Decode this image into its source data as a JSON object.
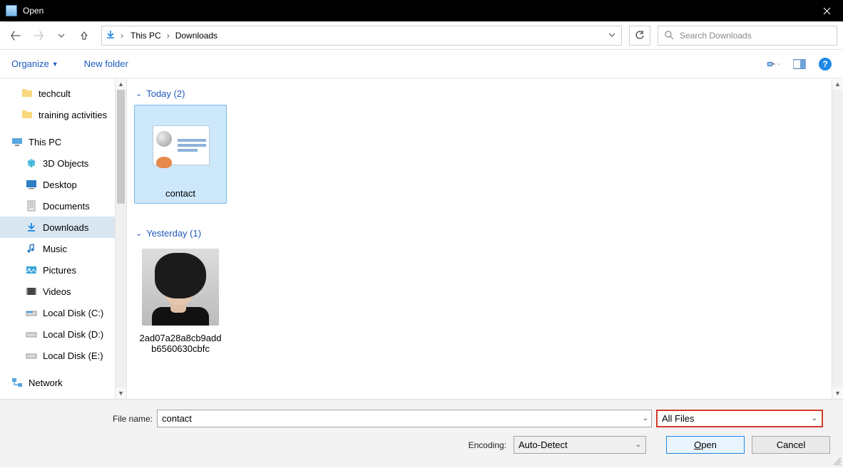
{
  "window": {
    "title": "Open"
  },
  "breadcrumb": {
    "root": "This PC",
    "folder": "Downloads"
  },
  "search": {
    "placeholder": "Search Downloads"
  },
  "toolbar": {
    "organize": "Organize",
    "new_folder": "New folder"
  },
  "sidebar": {
    "quick": [
      "techcult",
      "training activities"
    ],
    "this_pc": "This PC",
    "items": [
      "3D Objects",
      "Desktop",
      "Documents",
      "Downloads",
      "Music",
      "Pictures",
      "Videos",
      "Local Disk (C:)",
      "Local Disk (D:)",
      "Local Disk (E:)"
    ],
    "network": "Network"
  },
  "groups": {
    "today": {
      "label": "Today (2)",
      "items": [
        {
          "name": "contact",
          "selected": true
        }
      ]
    },
    "yesterday": {
      "label": "Yesterday (1)",
      "items": [
        {
          "name": "2ad07a28a8cb9addb6560630cbfc"
        }
      ]
    }
  },
  "footer": {
    "file_name_label": "File name:",
    "file_name_value": "contact",
    "file_type": "All Files",
    "encoding_label": "Encoding:",
    "encoding_value": "Auto-Detect",
    "open": "pen",
    "open_accel": "O",
    "cancel": "Cancel"
  }
}
